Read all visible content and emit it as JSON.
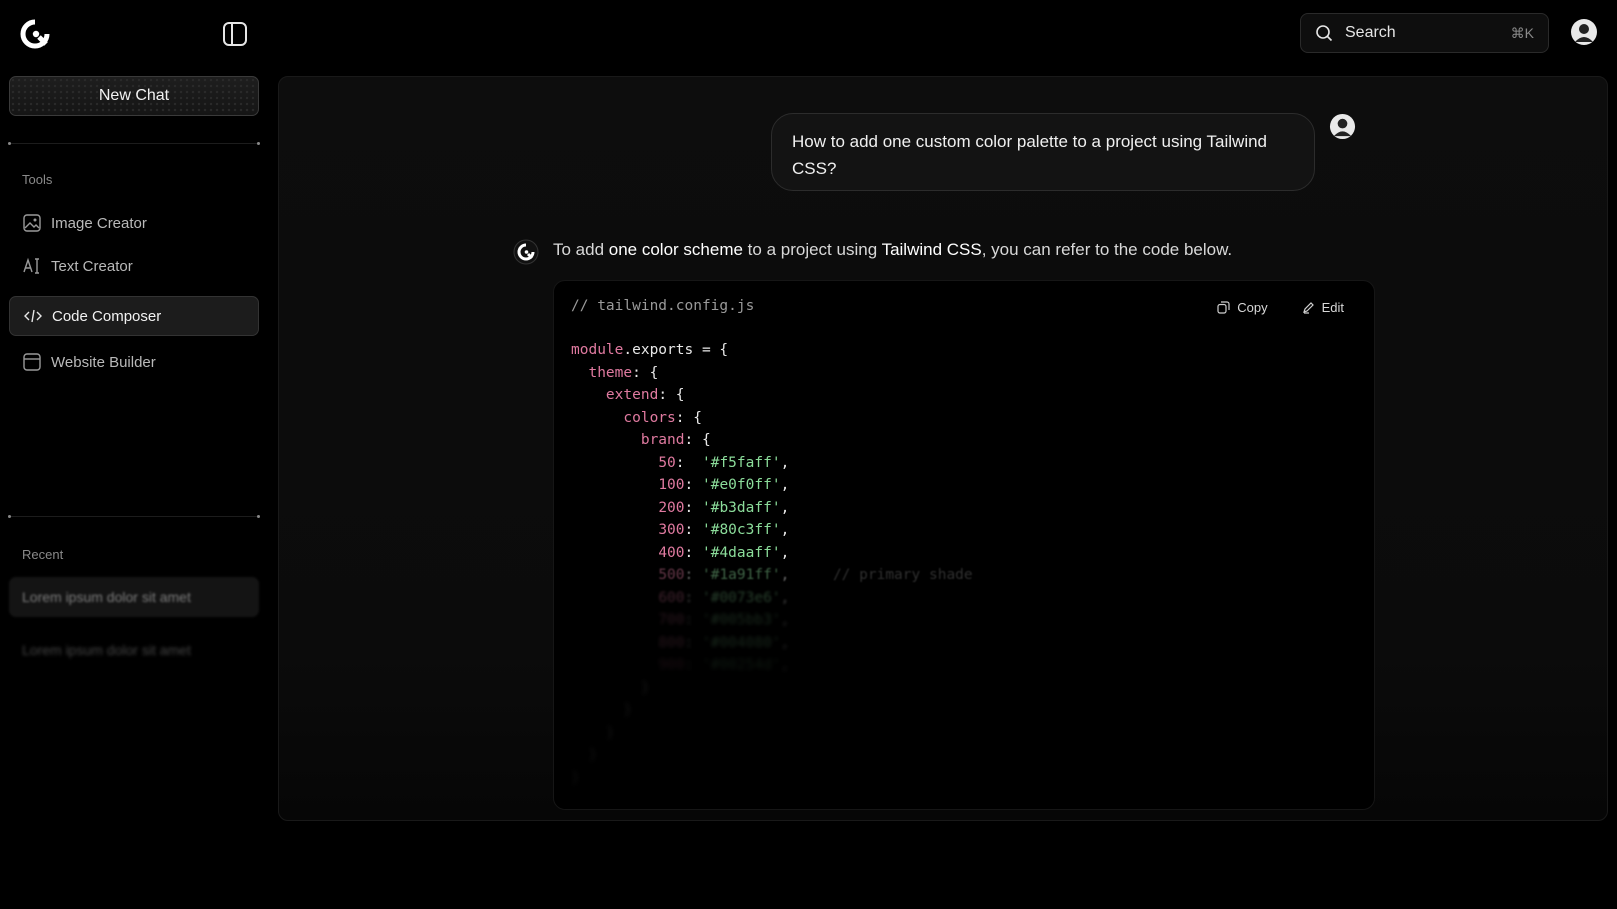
{
  "header": {
    "logo_icon": "assistant-logo-icon",
    "sidebar_toggle_icon": "sidebar-toggle-icon",
    "search": {
      "label": "Search",
      "shortcut": "⌘K"
    },
    "avatar_icon": "user-avatar-icon"
  },
  "sidebar": {
    "new_chat_label": "New Chat",
    "tools_label": "Tools",
    "tools": [
      {
        "label": "Image Creator",
        "icon": "image-icon"
      },
      {
        "label": "Text Creator",
        "icon": "text-cursor-icon"
      },
      {
        "label": "Code Composer",
        "icon": "code-icon",
        "active": true
      },
      {
        "label": "Website Builder",
        "icon": "browser-window-icon"
      }
    ],
    "recent_label": "Recent",
    "recent": [
      {
        "label": "Lorem ipsum dolor sit amet"
      },
      {
        "label": "Lorem ipsum dolor sit amet"
      }
    ]
  },
  "chat": {
    "user_message": "How to add one custom color palette to a project using Tailwind CSS?",
    "assistant": {
      "intro_1": "To add ",
      "intro_bold_1": "one color scheme",
      "intro_2": " to a project using ",
      "intro_bold_2": "Tailwind CSS",
      "intro_3": ", you can refer to the code below."
    },
    "code": {
      "filename": "// tailwind.config.js",
      "copy_label": "Copy",
      "edit_label": "Edit",
      "module": "module",
      "exports": ".exports = {",
      "theme": "theme",
      "extend": "extend",
      "colors": "colors",
      "brand": "brand",
      "shades": [
        {
          "key": "50",
          "value": "'#f5faff'"
        },
        {
          "key": "100",
          "value": "'#e0f0ff'"
        },
        {
          "key": "200",
          "value": "'#b3daff'"
        },
        {
          "key": "300",
          "value": "'#80c3ff'"
        },
        {
          "key": "400",
          "value": "'#4daaff'"
        },
        {
          "key": "500",
          "value": "'#1a91ff'",
          "comment": "// primary shade"
        },
        {
          "key": "600",
          "value": "'#0073e6'"
        },
        {
          "key": "700",
          "value": "'#005bb3'"
        },
        {
          "key": "800",
          "value": "'#004080'"
        },
        {
          "key": "900",
          "value": "'#00254d'"
        }
      ]
    }
  },
  "colors": {
    "background": "#000000",
    "keyword": "#e07aa0",
    "string": "#8bdc9a",
    "comment": "#6a6a6a"
  }
}
